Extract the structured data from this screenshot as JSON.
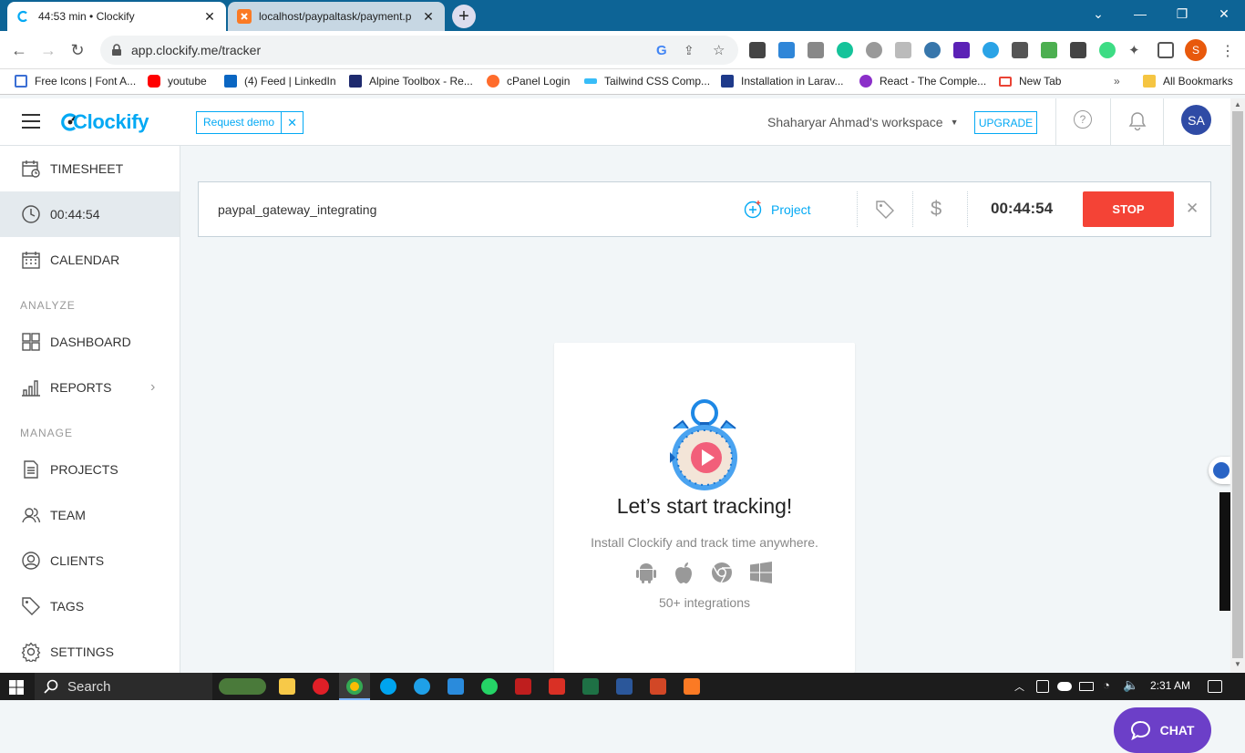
{
  "browser": {
    "tabs": [
      {
        "title": "44:53 min • Clockify",
        "active": true
      },
      {
        "title": "localhost/paypaltask/payment.p",
        "active": false
      }
    ],
    "url": "app.clockify.me/tracker",
    "bookmarks": [
      {
        "label": "Free Icons | Font A...",
        "color": "#3b6fd4"
      },
      {
        "label": "youtube",
        "color": "#ff0000"
      },
      {
        "label": "(4) Feed | LinkedIn",
        "color": "#0a66c2"
      },
      {
        "label": "Alpine Toolbox - Re...",
        "color": "#1e2a6e"
      },
      {
        "label": "cPanel Login",
        "color": "#ff6c2c"
      },
      {
        "label": "Tailwind CSS Comp...",
        "color": "#38bdf8"
      },
      {
        "label": "Installation in Larav...",
        "color": "#1e3a8a"
      },
      {
        "label": "React - The Comple...",
        "color": "#8b2fc9"
      },
      {
        "label": "New Tab",
        "color": "#ea4335"
      }
    ],
    "all_bookmarks": "All Bookmarks",
    "overflow": "»"
  },
  "header": {
    "logo": "Clockify",
    "request_demo": "Request demo",
    "workspace": "Shaharyar Ahmad's workspace",
    "upgrade": "UPGRADE",
    "avatar": "SA"
  },
  "sidebar": {
    "items": [
      {
        "label": "TIMESHEET",
        "icon": "timesheet-icon"
      },
      {
        "label": "00:44:54",
        "icon": "clock-icon"
      },
      {
        "label": "CALENDAR",
        "icon": "calendar-icon"
      }
    ],
    "analyze_header": "ANALYZE",
    "analyze_items": [
      {
        "label": "DASHBOARD",
        "icon": "dashboard-icon"
      },
      {
        "label": "REPORTS",
        "icon": "reports-icon"
      }
    ],
    "manage_header": "MANAGE",
    "manage_items": [
      {
        "label": "PROJECTS",
        "icon": "projects-icon"
      },
      {
        "label": "TEAM",
        "icon": "team-icon"
      },
      {
        "label": "CLIENTS",
        "icon": "clients-icon"
      },
      {
        "label": "TAGS",
        "icon": "tag-icon"
      },
      {
        "label": "SETTINGS",
        "icon": "settings-icon"
      }
    ]
  },
  "tracker": {
    "description": "paypal_gateway_integrating",
    "project_label": "Project",
    "timer": "00:44:54",
    "stop_label": "STOP"
  },
  "empty_state": {
    "title": "Let’s start tracking!",
    "subtitle": "Install Clockify and track time anywhere.",
    "integrations": "50+ integrations"
  },
  "chat": {
    "label": "CHAT"
  },
  "taskbar": {
    "search_placeholder": "Search",
    "time": "2:31 AM"
  },
  "colors": {
    "brand": "#03a9f4",
    "stop": "#f44336",
    "chat": "#6c3fc8",
    "tab_strip": "#0d6496",
    "avatar": "#2f4ba5"
  }
}
